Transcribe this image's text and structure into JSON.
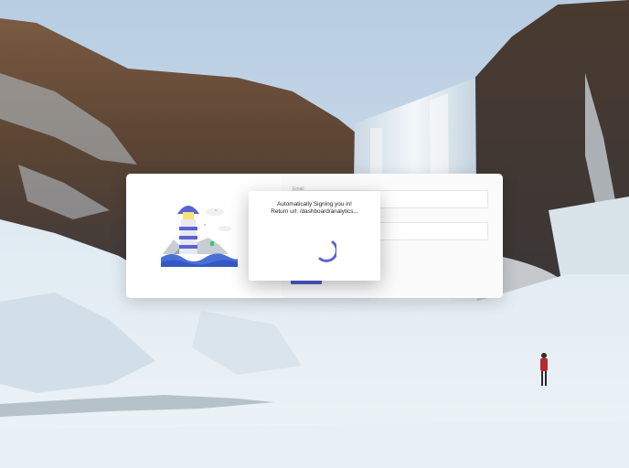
{
  "modal": {
    "title": "Automatically Signing you in!",
    "return_url": "Return url: /dashboard/analytics..."
  },
  "login_form": {
    "email_label": "Email",
    "button_color": "#4f5fd0"
  },
  "icons": {
    "illustration": "lighthouse-illustration",
    "spinner": "loading-spinner-icon"
  },
  "colors": {
    "accent": "#5b63d3",
    "card": "#ffffff"
  }
}
